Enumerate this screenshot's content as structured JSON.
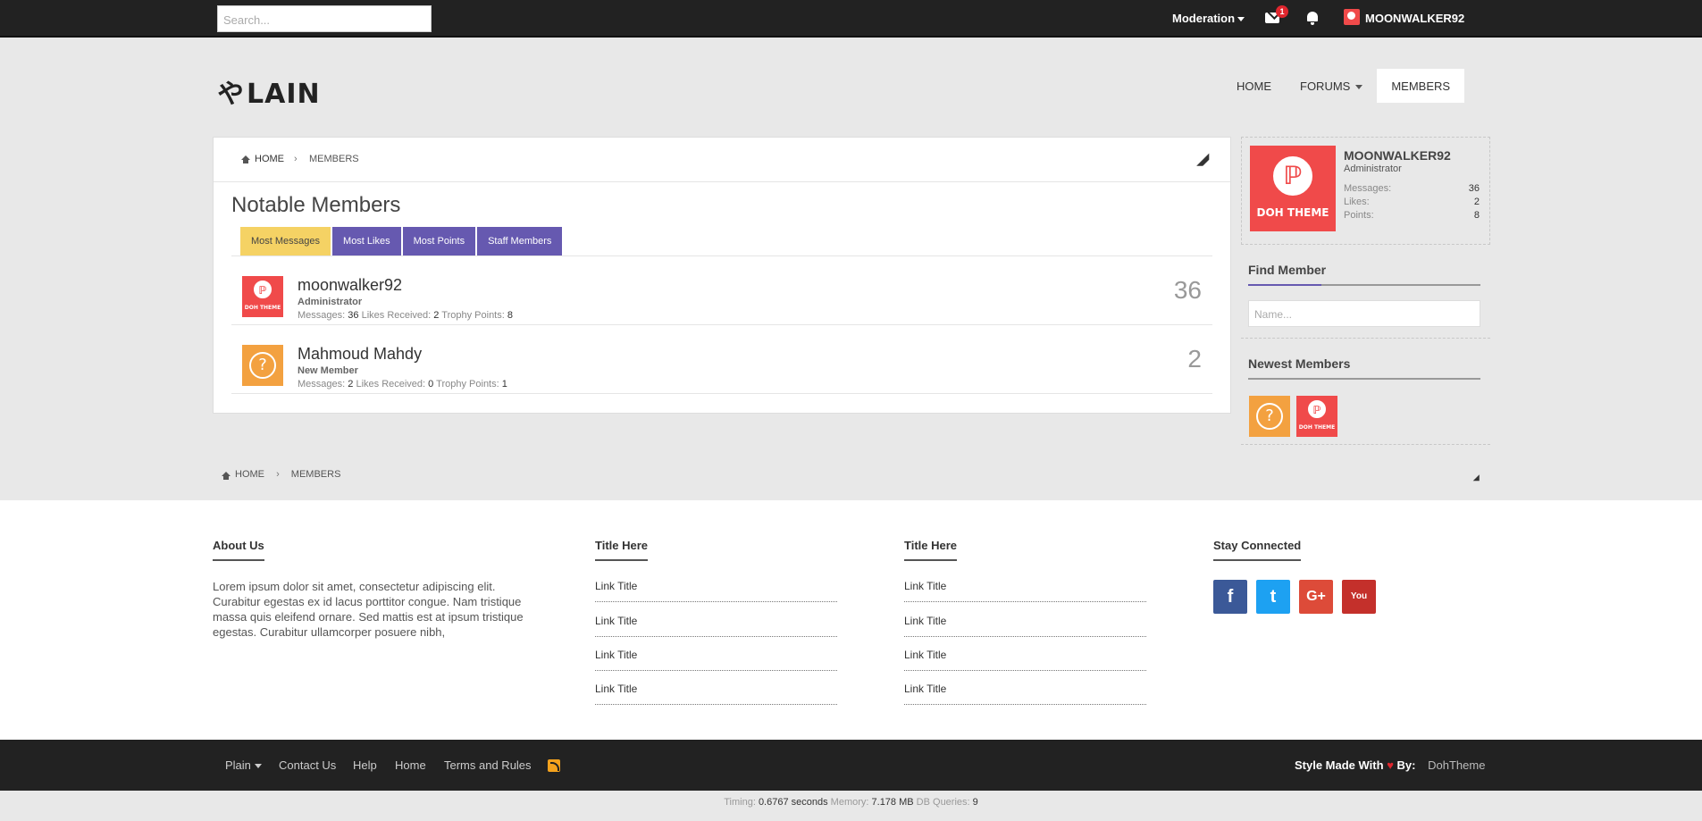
{
  "topbar": {
    "search_placeholder": "Search...",
    "moderation_label": "Moderation",
    "inbox_badge": "1",
    "username": "MOONWALKER92"
  },
  "header": {
    "logo_glyph": "や",
    "logo_text": "LAIN",
    "nav": [
      {
        "label": "HOME"
      },
      {
        "label": "FORUMS"
      },
      {
        "label": "MEMBERS"
      }
    ]
  },
  "breadcrumb": {
    "home": "HOME",
    "separator": "›",
    "current": "MEMBERS"
  },
  "main": {
    "title": "Notable Members",
    "tabs": [
      {
        "label": "Most Messages"
      },
      {
        "label": "Most Likes"
      },
      {
        "label": "Most Points"
      },
      {
        "label": "Staff Members"
      }
    ],
    "members": [
      {
        "name": "moonwalker92",
        "title": "Administrator",
        "messages_label": "Messages:",
        "messages": "36",
        "likes_label": "Likes Received:",
        "likes": "2",
        "points_label": "Trophy Points:",
        "points": "8",
        "score": "36",
        "avatar": "doh-theme-avatar"
      },
      {
        "name": "Mahmoud Mahdy",
        "title": "New Member",
        "messages_label": "Messages:",
        "messages": "2",
        "likes_label": "Likes Received:",
        "likes": "0",
        "points_label": "Trophy Points:",
        "points": "1",
        "score": "2",
        "avatar": "question-mark-avatar"
      }
    ]
  },
  "sidebar": {
    "profile": {
      "name": "MOONWALKER92",
      "role": "Administrator",
      "avatar_text": "DOH THEME",
      "stats": [
        {
          "label": "Messages:",
          "value": "36"
        },
        {
          "label": "Likes:",
          "value": "2"
        },
        {
          "label": "Points:",
          "value": "8"
        }
      ]
    },
    "find_member": {
      "heading": "Find Member",
      "placeholder": "Name..."
    },
    "newest_members": {
      "heading": "Newest Members"
    }
  },
  "footer": {
    "about": {
      "heading": "About Us",
      "text": "Lorem ipsum dolor sit amet, consectetur adipiscing elit. Curabitur egestas ex id lacus porttitor congue. Nam tristique massa quis eleifend ornare. Sed mattis est at ipsum tristique egestas. Curabitur ullamcorper posuere nibh,"
    },
    "col2": {
      "heading": "Title Here",
      "links": [
        "Link Title",
        "Link Title",
        "Link Title",
        "Link Title"
      ]
    },
    "col3": {
      "heading": "Title Here",
      "links": [
        "Link Title",
        "Link Title",
        "Link Title",
        "Link Title"
      ]
    },
    "connected": {
      "heading": "Stay Connected",
      "icons": [
        {
          "name": "facebook-icon",
          "glyph": "f",
          "color": "#3b5998"
        },
        {
          "name": "twitter-icon",
          "glyph": "t",
          "color": "#1da1f2"
        },
        {
          "name": "google-plus-icon",
          "glyph": "G+",
          "color": "#dd4b39"
        },
        {
          "name": "youtube-icon",
          "glyph": "You",
          "color": "#c4302b"
        }
      ]
    }
  },
  "bottombar": {
    "links": [
      "Plain",
      "Contact Us",
      "Help",
      "Home",
      "Terms and Rules"
    ],
    "style_made": "Style Made With",
    "heart": "♥",
    "by": "By:",
    "author": "DohTheme"
  },
  "debug": {
    "timing_label": "Timing:",
    "timing": "0.6767 seconds",
    "memory_label": "Memory:",
    "memory": "7.178 MB",
    "queries_label": "DB Queries:",
    "queries": "9"
  },
  "colors": {
    "accent": "#6659b0",
    "tab_active": "#f5d264",
    "avatar_red": "#f04a4a",
    "avatar_orange": "#f3a140"
  }
}
